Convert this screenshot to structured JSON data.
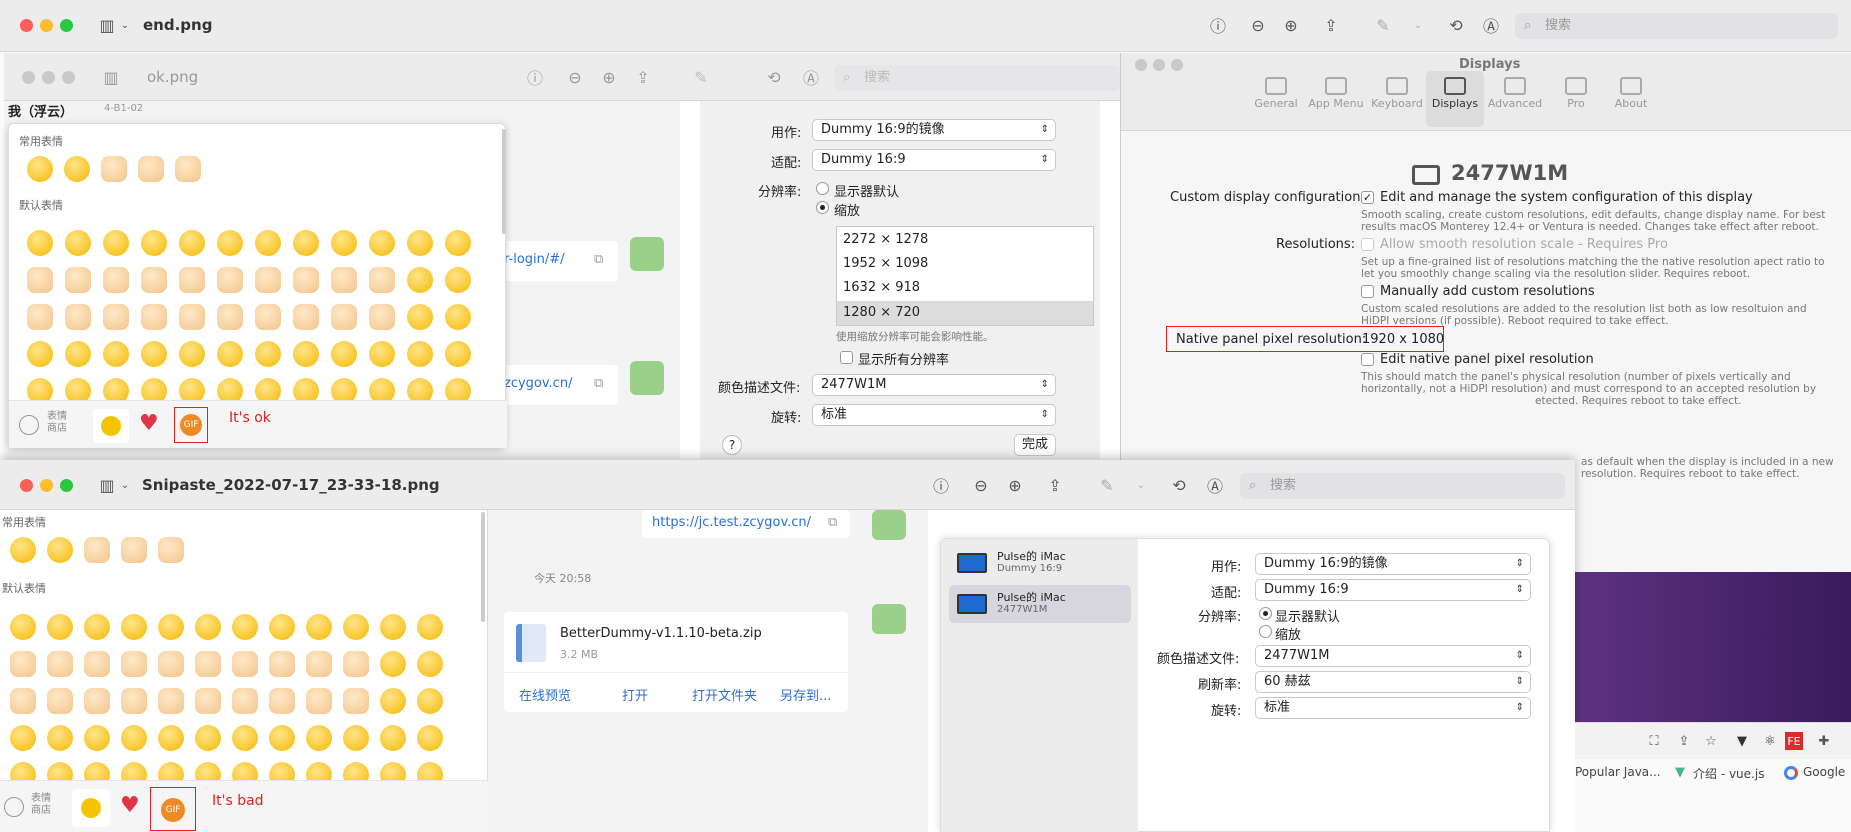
{
  "win_end": {
    "title": "end.png",
    "search_placeholder": "搜索"
  },
  "win_ok": {
    "title": "ok.png",
    "search_placeholder": "搜索"
  },
  "win_snip": {
    "title": "Snipaste_2022-07-17_23-33-18.png",
    "search_placeholder": "搜索"
  },
  "chat_top": {
    "header_name": "我（浮云）",
    "header_sub": "4-B1-02",
    "link1": "r-login/#/",
    "link2": "zcygov.cn/"
  },
  "emoji_panel_top": {
    "frequent_label": "常用表情",
    "default_label": "默认表情",
    "store_label": "表情\n商店",
    "gif_label": "GIF",
    "note": "It's ok"
  },
  "emoji_panel_bottom": {
    "frequent_label": "常用表情",
    "default_label": "默认表情",
    "store_label": "表情\n商店",
    "gif_label": "GIF",
    "note": "It's bad"
  },
  "display_top": {
    "use_label": "用作:",
    "use_value": "Dummy 16:9的镜像",
    "fit_label": "适配:",
    "fit_value": "Dummy 16:9",
    "res_label": "分辨率:",
    "res_default": "显示器默认",
    "res_scaled": "缩放",
    "res_list": [
      "2272 × 1278",
      "1952 × 1098",
      "1632 × 918",
      "1280 × 720"
    ],
    "res_note": "使用缩放分辨率可能会影响性能。",
    "show_all": "显示所有分辨率",
    "color_label": "颜色描述文件:",
    "color_value": "2477W1M",
    "rotate_label": "旋转:",
    "rotate_value": "标准",
    "help": "?",
    "done": "完成"
  },
  "displays": {
    "title": "Displays",
    "tabs": [
      "General",
      "App Menu",
      "Keyboard",
      "Displays",
      "Advanced",
      "Pro",
      "About"
    ],
    "monitor_name": "2477W1M",
    "custom_config_label": "Custom display configuration:",
    "custom_config_check": "Edit and manage the system configuration of this display",
    "custom_config_desc1": "Smooth scaling, create custom resolutions, edit defaults, change display name. For best",
    "custom_config_desc2": "results macOS Monterey 12.4+ or Ventura is needed. Changes take effect after reboot.",
    "resolutions_label": "Resolutions:",
    "smooth_check": "Allow smooth resolution scale - Requires Pro",
    "smooth_desc1": "Set up a fine-grained list of resolutions matching the the native resolution apect ratio to",
    "smooth_desc2": "let you smoothly change scaling via the resolution slider. Requires reboot.",
    "manual_check": "Manually add custom resolutions",
    "manual_desc1": "Custom scaled resolutions are added to the resolution list both as low resoltuion and",
    "manual_desc2": "HiDPI versions (if possible). Reboot required to take effect.",
    "native_label": "Native panel pixel resolution:",
    "native_value": "1920 x 1080",
    "edit_native_check": "Edit native panel pixel resolution",
    "edit_native_desc1": "This should match the panel's physical resolution (number of pixels vertically and",
    "edit_native_desc2": "horizontally, not a HiDPI resolution) and must correspond to an accepted resolution by",
    "edit_native_desc3": "etected. Requires reboot to take effect.",
    "extra_desc1": "as default when the display is included in a new",
    "extra_desc2": "resolution. Requires reboot to take effect."
  },
  "chat_bottom": {
    "link": "https://jc.test.zcygov.cn/",
    "time": "今天 20:58",
    "file_name": "BetterDummy-v1.1.10-beta.zip",
    "file_size": "3.2 MB",
    "actions": [
      "在线预览",
      "打开",
      "打开文件夹",
      "另存到..."
    ]
  },
  "display_bottom": {
    "sidebar": [
      {
        "name": "Pulse的 iMac",
        "sub": "Dummy 16:9"
      },
      {
        "name": "Pulse的 iMac",
        "sub": "2477W1M"
      }
    ],
    "use_label": "用作:",
    "use_value": "Dummy 16:9的镜像",
    "fit_label": "适配:",
    "fit_value": "Dummy 16:9",
    "res_label": "分辨率:",
    "res_default": "显示器默认",
    "res_scaled": "缩放",
    "color_label": "颜色描述文件:",
    "color_value": "2477W1M",
    "refresh_label": "刷新率:",
    "refresh_value": "60 赫兹",
    "rotate_label": "旋转:",
    "rotate_value": "标准"
  },
  "browser": {
    "bookmarks": [
      "Popular Java...",
      "介绍 - vue.js",
      "Google"
    ]
  }
}
